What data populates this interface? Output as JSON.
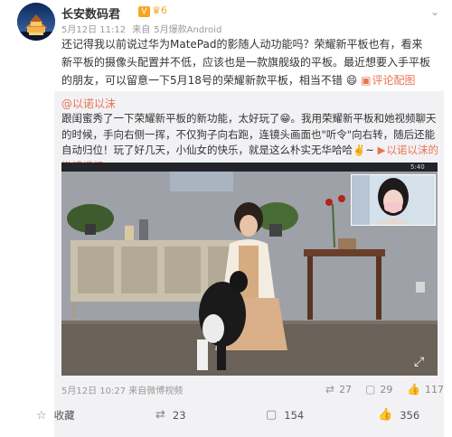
{
  "header": {
    "username": "长安数码君",
    "vip_badge": "V",
    "vip_level": "6",
    "date": "5月12日 11:12",
    "source_prefix": "来自",
    "source": "5月爆款Android",
    "menu_icon": "chevron-down-icon"
  },
  "post": {
    "text_before": "还记得我以前说过华为MatePad的影随人动功能吗？荣耀新平板也有，看来新平板的摄像头配置并不低，应该也是一款旗舰级的平板。最近想要入手平板的朋友，可以留意一下5月18号的荣耀新款平板，相当不错",
    "emoji": "😄",
    "link_label": "评论配图",
    "link_icon": "image-icon"
  },
  "repost": {
    "author": "@以诺以沫",
    "text": "跟闺蜜秀了一下荣耀新平板的新功能，太好玩了😁。我用荣耀新平板和她视频聊天的时候，手向右侧一挥，不仅狗子向右跑，连镜头画面也\"听令\"向右转，随后还能自动归位！玩了好几天，小仙女的快乐，就是这么朴实无华哈哈✌️~",
    "video_link_label": "以诺以沫的微博视频",
    "video_link_icon": "play-icon",
    "video_time": "5:40",
    "date": "5月12日 10:27",
    "source_prefix": "来自",
    "source": "微博视频",
    "repost_count": "27",
    "comment_count": "29",
    "like_count": "117"
  },
  "actions": {
    "favorite_label": "收藏",
    "repost_count": "23",
    "comment_count": "154",
    "like_count": "356"
  },
  "colors": {
    "link": "#eb7350",
    "repost_bg": "#f2f2f5",
    "meta_text": "#999999"
  }
}
